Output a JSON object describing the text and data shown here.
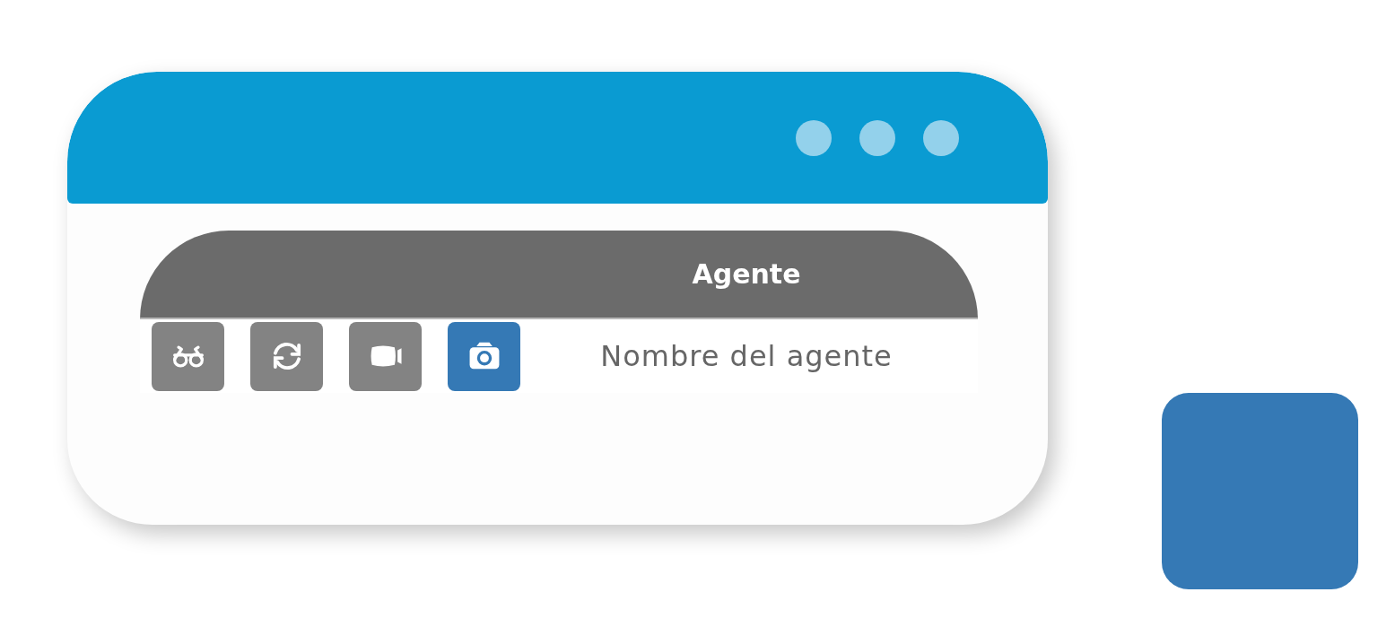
{
  "table": {
    "columns": [
      {
        "label": "Agente"
      }
    ],
    "tools": [
      {
        "kind": "glasses",
        "selected": false
      },
      {
        "kind": "refresh",
        "selected": false
      },
      {
        "kind": "video",
        "selected": false
      },
      {
        "kind": "camera",
        "selected": true
      }
    ],
    "row": {
      "name": "Nombre del agente"
    }
  }
}
